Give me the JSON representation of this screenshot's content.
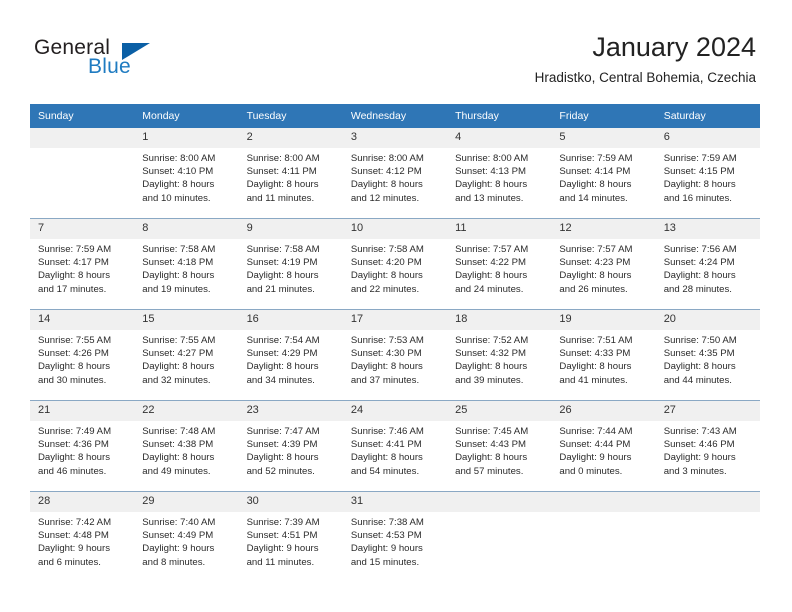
{
  "brand": {
    "name_part1": "General",
    "name_part2": "Blue",
    "triangle_icon": "triangle-icon",
    "colors": {
      "dark": "#231f20",
      "blue": "#1f7bc1",
      "triangle": "#0b5fa5"
    }
  },
  "header": {
    "title": "January 2024",
    "subtitle": "Hradistko, Central Bohemia, Czechia"
  },
  "theme": {
    "header_bar": "#2f76b6",
    "daynum_band": "#f0f0f0",
    "row_separator": "#8aa8c4"
  },
  "calendar": {
    "weekday_headers": [
      "Sunday",
      "Monday",
      "Tuesday",
      "Wednesday",
      "Thursday",
      "Friday",
      "Saturday"
    ],
    "weeks": [
      [
        {
          "day": "",
          "lines": [
            "",
            "",
            "",
            ""
          ]
        },
        {
          "day": "1",
          "lines": [
            "Sunrise: 8:00 AM",
            "Sunset: 4:10 PM",
            "Daylight: 8 hours",
            "and 10 minutes."
          ]
        },
        {
          "day": "2",
          "lines": [
            "Sunrise: 8:00 AM",
            "Sunset: 4:11 PM",
            "Daylight: 8 hours",
            "and 11 minutes."
          ]
        },
        {
          "day": "3",
          "lines": [
            "Sunrise: 8:00 AM",
            "Sunset: 4:12 PM",
            "Daylight: 8 hours",
            "and 12 minutes."
          ]
        },
        {
          "day": "4",
          "lines": [
            "Sunrise: 8:00 AM",
            "Sunset: 4:13 PM",
            "Daylight: 8 hours",
            "and 13 minutes."
          ]
        },
        {
          "day": "5",
          "lines": [
            "Sunrise: 7:59 AM",
            "Sunset: 4:14 PM",
            "Daylight: 8 hours",
            "and 14 minutes."
          ]
        },
        {
          "day": "6",
          "lines": [
            "Sunrise: 7:59 AM",
            "Sunset: 4:15 PM",
            "Daylight: 8 hours",
            "and 16 minutes."
          ]
        }
      ],
      [
        {
          "day": "7",
          "lines": [
            "Sunrise: 7:59 AM",
            "Sunset: 4:17 PM",
            "Daylight: 8 hours",
            "and 17 minutes."
          ]
        },
        {
          "day": "8",
          "lines": [
            "Sunrise: 7:58 AM",
            "Sunset: 4:18 PM",
            "Daylight: 8 hours",
            "and 19 minutes."
          ]
        },
        {
          "day": "9",
          "lines": [
            "Sunrise: 7:58 AM",
            "Sunset: 4:19 PM",
            "Daylight: 8 hours",
            "and 21 minutes."
          ]
        },
        {
          "day": "10",
          "lines": [
            "Sunrise: 7:58 AM",
            "Sunset: 4:20 PM",
            "Daylight: 8 hours",
            "and 22 minutes."
          ]
        },
        {
          "day": "11",
          "lines": [
            "Sunrise: 7:57 AM",
            "Sunset: 4:22 PM",
            "Daylight: 8 hours",
            "and 24 minutes."
          ]
        },
        {
          "day": "12",
          "lines": [
            "Sunrise: 7:57 AM",
            "Sunset: 4:23 PM",
            "Daylight: 8 hours",
            "and 26 minutes."
          ]
        },
        {
          "day": "13",
          "lines": [
            "Sunrise: 7:56 AM",
            "Sunset: 4:24 PM",
            "Daylight: 8 hours",
            "and 28 minutes."
          ]
        }
      ],
      [
        {
          "day": "14",
          "lines": [
            "Sunrise: 7:55 AM",
            "Sunset: 4:26 PM",
            "Daylight: 8 hours",
            "and 30 minutes."
          ]
        },
        {
          "day": "15",
          "lines": [
            "Sunrise: 7:55 AM",
            "Sunset: 4:27 PM",
            "Daylight: 8 hours",
            "and 32 minutes."
          ]
        },
        {
          "day": "16",
          "lines": [
            "Sunrise: 7:54 AM",
            "Sunset: 4:29 PM",
            "Daylight: 8 hours",
            "and 34 minutes."
          ]
        },
        {
          "day": "17",
          "lines": [
            "Sunrise: 7:53 AM",
            "Sunset: 4:30 PM",
            "Daylight: 8 hours",
            "and 37 minutes."
          ]
        },
        {
          "day": "18",
          "lines": [
            "Sunrise: 7:52 AM",
            "Sunset: 4:32 PM",
            "Daylight: 8 hours",
            "and 39 minutes."
          ]
        },
        {
          "day": "19",
          "lines": [
            "Sunrise: 7:51 AM",
            "Sunset: 4:33 PM",
            "Daylight: 8 hours",
            "and 41 minutes."
          ]
        },
        {
          "day": "20",
          "lines": [
            "Sunrise: 7:50 AM",
            "Sunset: 4:35 PM",
            "Daylight: 8 hours",
            "and 44 minutes."
          ]
        }
      ],
      [
        {
          "day": "21",
          "lines": [
            "Sunrise: 7:49 AM",
            "Sunset: 4:36 PM",
            "Daylight: 8 hours",
            "and 46 minutes."
          ]
        },
        {
          "day": "22",
          "lines": [
            "Sunrise: 7:48 AM",
            "Sunset: 4:38 PM",
            "Daylight: 8 hours",
            "and 49 minutes."
          ]
        },
        {
          "day": "23",
          "lines": [
            "Sunrise: 7:47 AM",
            "Sunset: 4:39 PM",
            "Daylight: 8 hours",
            "and 52 minutes."
          ]
        },
        {
          "day": "24",
          "lines": [
            "Sunrise: 7:46 AM",
            "Sunset: 4:41 PM",
            "Daylight: 8 hours",
            "and 54 minutes."
          ]
        },
        {
          "day": "25",
          "lines": [
            "Sunrise: 7:45 AM",
            "Sunset: 4:43 PM",
            "Daylight: 8 hours",
            "and 57 minutes."
          ]
        },
        {
          "day": "26",
          "lines": [
            "Sunrise: 7:44 AM",
            "Sunset: 4:44 PM",
            "Daylight: 9 hours",
            "and 0 minutes."
          ]
        },
        {
          "day": "27",
          "lines": [
            "Sunrise: 7:43 AM",
            "Sunset: 4:46 PM",
            "Daylight: 9 hours",
            "and 3 minutes."
          ]
        }
      ],
      [
        {
          "day": "28",
          "lines": [
            "Sunrise: 7:42 AM",
            "Sunset: 4:48 PM",
            "Daylight: 9 hours",
            "and 6 minutes."
          ]
        },
        {
          "day": "29",
          "lines": [
            "Sunrise: 7:40 AM",
            "Sunset: 4:49 PM",
            "Daylight: 9 hours",
            "and 8 minutes."
          ]
        },
        {
          "day": "30",
          "lines": [
            "Sunrise: 7:39 AM",
            "Sunset: 4:51 PM",
            "Daylight: 9 hours",
            "and 11 minutes."
          ]
        },
        {
          "day": "31",
          "lines": [
            "Sunrise: 7:38 AM",
            "Sunset: 4:53 PM",
            "Daylight: 9 hours",
            "and 15 minutes."
          ]
        },
        {
          "day": "",
          "lines": [
            "",
            "",
            "",
            ""
          ]
        },
        {
          "day": "",
          "lines": [
            "",
            "",
            "",
            ""
          ]
        },
        {
          "day": "",
          "lines": [
            "",
            "",
            "",
            ""
          ]
        }
      ]
    ]
  }
}
